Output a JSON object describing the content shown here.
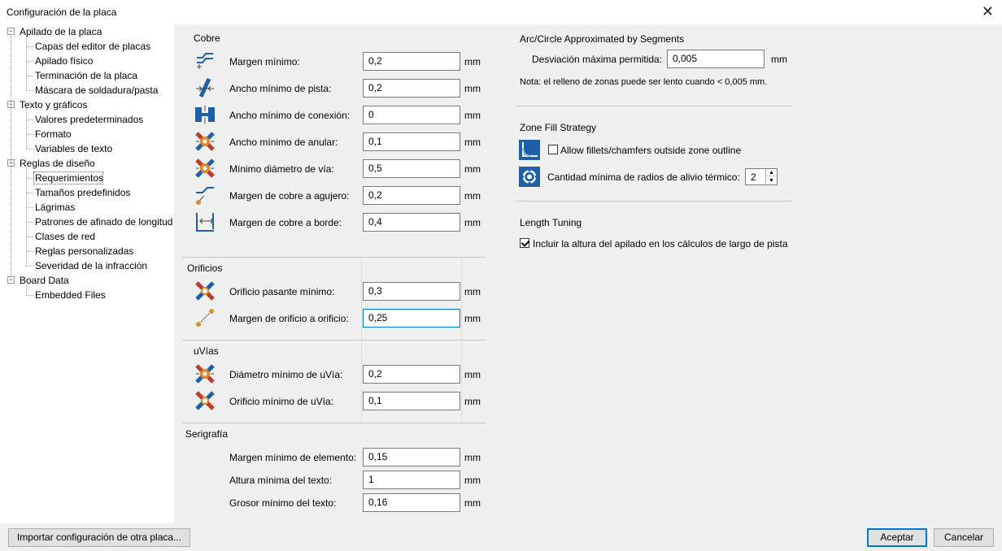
{
  "window": {
    "title": "Configuración de la placa"
  },
  "tree": [
    {
      "label": "Apilado de la placa",
      "expander": "-"
    },
    {
      "label": "Capas del editor de placas"
    },
    {
      "label": "Apilado físico"
    },
    {
      "label": "Terminación de la placa"
    },
    {
      "label": "Máscara de soldadura/pasta"
    },
    {
      "label": "Texto y gráficos",
      "expander": "-"
    },
    {
      "label": "Valores predeterminados"
    },
    {
      "label": "Formato"
    },
    {
      "label": "Variables de texto"
    },
    {
      "label": "Reglas de diseño",
      "expander": "-"
    },
    {
      "label": "Requerimientos",
      "selected": true
    },
    {
      "label": "Tamaños predefinidos"
    },
    {
      "label": "Lágrimas"
    },
    {
      "label": "Patrones de afinado de longitud"
    },
    {
      "label": "Clases de red"
    },
    {
      "label": "Reglas personalizadas"
    },
    {
      "label": "Severidad de la infracción"
    },
    {
      "label": "Board Data",
      "expander": "-"
    },
    {
      "label": "Embedded Files"
    }
  ],
  "copper": {
    "title": "Cobre",
    "rows": [
      {
        "label": "Margen mínimo:",
        "value": "0,2",
        "unit": "mm",
        "icon": "clearance-icon"
      },
      {
        "label": "Ancho mínimo de pista:",
        "value": "0,2",
        "unit": "mm",
        "icon": "track-width-icon"
      },
      {
        "label": "Ancho mínimo de conexión:",
        "value": "0",
        "unit": "mm",
        "icon": "connection-width-icon"
      },
      {
        "label": "Ancho mínimo de anular:",
        "value": "0,1",
        "unit": "mm",
        "icon": "annular-width-icon"
      },
      {
        "label": "Mínimo diámetro de vía:",
        "value": "0,5",
        "unit": "mm",
        "icon": "via-diameter-icon"
      },
      {
        "label": "Margen de cobre a agujero:",
        "value": "0,2",
        "unit": "mm",
        "icon": "hole-clearance-icon"
      },
      {
        "label": "Margen de cobre a borde:",
        "value": "0,4",
        "unit": "mm",
        "icon": "edge-clearance-icon"
      }
    ]
  },
  "holes": {
    "title": "Orificios",
    "rows": [
      {
        "label": "Orificio pasante mínimo:",
        "value": "0,3",
        "unit": "mm",
        "icon": "through-hole-icon"
      },
      {
        "label": "Margen de orificio a orificio:",
        "value": "0,25",
        "unit": "mm",
        "icon": "hole-to-hole-icon"
      }
    ]
  },
  "uvias": {
    "title": "uVías",
    "rows": [
      {
        "label": "Diámetro mínimo de uVía:",
        "value": "0,2",
        "unit": "mm",
        "icon": "uvia-diameter-icon"
      },
      {
        "label": "Orificio mínimo de uVía:",
        "value": "0,1",
        "unit": "mm",
        "icon": "uvia-hole-icon"
      }
    ]
  },
  "silk": {
    "title": "Serigrafía",
    "rows": [
      {
        "label": "Margen mínimo de elemento:",
        "value": "0,15",
        "unit": "mm"
      },
      {
        "label": "Altura mínima del texto:",
        "value": "1",
        "unit": "mm"
      },
      {
        "label": "Grosor mínimo del texto:",
        "value": "0,16",
        "unit": "mm"
      }
    ]
  },
  "arc": {
    "title": "Arc/Circle Approximated by Segments",
    "label": "Desviación máxima permitida:",
    "value": "0,005",
    "unit": "mm",
    "note": "Nota: el relleno de zonas puede ser lento cuando < 0,005 mm."
  },
  "zone": {
    "title": "Zone Fill Strategy",
    "fillets_label": "Allow fillets/chamfers outside zone outline",
    "fillets_checked": false,
    "spokes_label": "Cantidad mínima de radios de alivio térmico:",
    "spokes_value": "2"
  },
  "length": {
    "title": "Length Tuning",
    "stackup_label": "Incluir la altura del apilado en los cálculos de largo de pista",
    "stackup_checked": true
  },
  "footer": {
    "import_label": "Importar configuración de otra placa...",
    "ok_label": "Aceptar",
    "cancel_label": "Cancelar"
  },
  "colors": {
    "accent": "#0078d7",
    "icon_blue": "#1f5fa8",
    "icon_orange": "#e0882a",
    "icon_red": "#c0392b"
  }
}
